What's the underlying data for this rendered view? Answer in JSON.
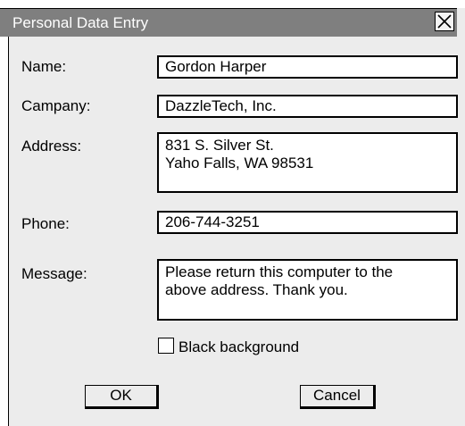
{
  "window": {
    "title": "Personal Data Entry"
  },
  "form": {
    "name_label": "Name:",
    "name_value": "Gordon Harper",
    "company_label": "Campany:",
    "company_value": "DazzleTech, Inc.",
    "address_label": "Address:",
    "address_value": "831 S. Silver St.\nYaho Falls, WA 98531",
    "phone_label": "Phone:",
    "phone_value": "206-744-3251",
    "message_label": "Message:",
    "message_value": "Please return this computer to the\nabove address.  Thank you.",
    "checkbox_label": "Black background",
    "checkbox_checked": false
  },
  "buttons": {
    "ok": "OK",
    "cancel": "Cancel"
  },
  "icons": {
    "close": "close-icon"
  }
}
